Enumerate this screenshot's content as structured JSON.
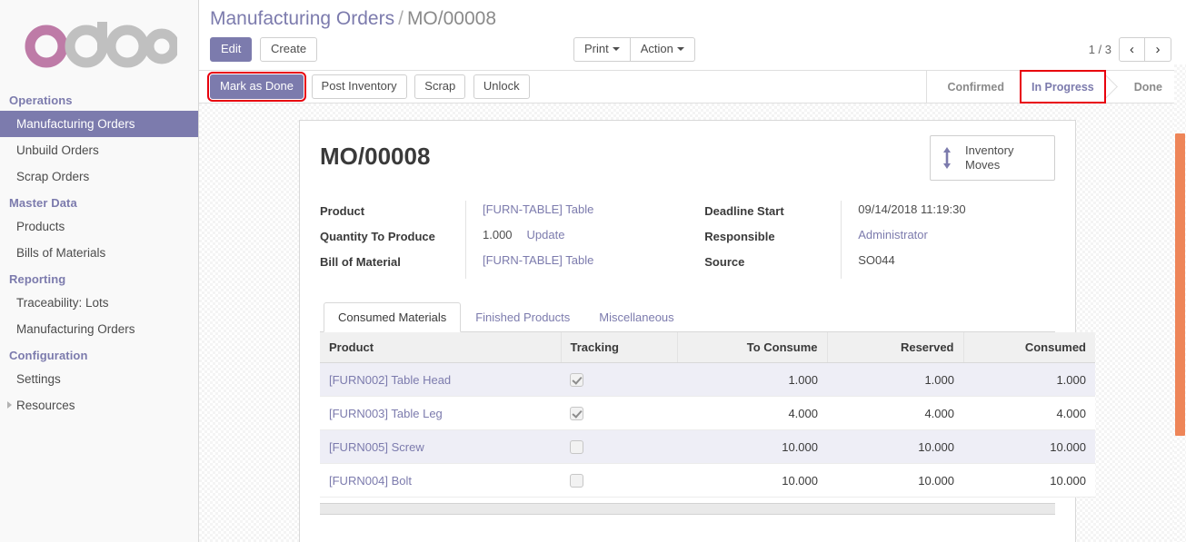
{
  "app": {
    "logo_alt": "odoo"
  },
  "sidebar": {
    "sections": [
      {
        "title": "Operations",
        "items": [
          {
            "label": "Manufacturing Orders",
            "active": true,
            "expandable": false
          },
          {
            "label": "Unbuild Orders",
            "active": false,
            "expandable": false
          },
          {
            "label": "Scrap Orders",
            "active": false,
            "expandable": false
          }
        ]
      },
      {
        "title": "Master Data",
        "items": [
          {
            "label": "Products",
            "active": false,
            "expandable": false
          },
          {
            "label": "Bills of Materials",
            "active": false,
            "expandable": false
          }
        ]
      },
      {
        "title": "Reporting",
        "items": [
          {
            "label": "Traceability: Lots",
            "active": false,
            "expandable": false
          },
          {
            "label": "Manufacturing Orders",
            "active": false,
            "expandable": false
          }
        ]
      },
      {
        "title": "Configuration",
        "items": [
          {
            "label": "Settings",
            "active": false,
            "expandable": false
          },
          {
            "label": "Resources",
            "active": false,
            "expandable": true
          }
        ]
      }
    ]
  },
  "breadcrumb": {
    "root": "Manufacturing Orders",
    "separator": "/",
    "current": "MO/00008"
  },
  "control_panel": {
    "edit_label": "Edit",
    "create_label": "Create",
    "print_label": "Print",
    "action_label": "Action",
    "pager_count": "1 / 3",
    "prev_icon": "‹",
    "next_icon": "›"
  },
  "action_bar": {
    "buttons": [
      {
        "label": "Mark as Done",
        "primary": true,
        "highlighted": true
      },
      {
        "label": "Post Inventory",
        "primary": false,
        "highlighted": false
      },
      {
        "label": "Scrap",
        "primary": false,
        "highlighted": false
      },
      {
        "label": "Unlock",
        "primary": false,
        "highlighted": false
      }
    ],
    "statusbar": [
      {
        "label": "Confirmed",
        "active": false,
        "highlighted": false
      },
      {
        "label": "In Progress",
        "active": true,
        "highlighted": true
      },
      {
        "label": "Done",
        "active": false,
        "highlighted": false
      }
    ]
  },
  "form": {
    "title": "MO/00008",
    "stat_button": {
      "label": "Inventory\nMoves",
      "icon": "up-down-arrow-icon"
    },
    "left_fields": [
      {
        "label": "Product",
        "value": "[FURN-TABLE] Table",
        "link": true
      },
      {
        "label": "Quantity To Produce",
        "value": "1.000",
        "link": false,
        "extra_link": "Update"
      },
      {
        "label": "Bill of Material",
        "value": "[FURN-TABLE] Table",
        "link": true
      }
    ],
    "right_fields": [
      {
        "label": "Deadline Start",
        "value": "09/14/2018 11:19:30",
        "link": false
      },
      {
        "label": "Responsible",
        "value": "Administrator",
        "link": true
      },
      {
        "label": "Source",
        "value": "SO044",
        "link": false
      }
    ]
  },
  "notebook": {
    "tabs": [
      {
        "label": "Consumed Materials",
        "active": true
      },
      {
        "label": "Finished Products",
        "active": false
      },
      {
        "label": "Miscellaneous",
        "active": false
      }
    ],
    "table": {
      "columns": [
        "Product",
        "Tracking",
        "To Consume",
        "Reserved",
        "Consumed"
      ],
      "rows": [
        {
          "product": "[FURN002] Table Head",
          "tracking": true,
          "to_consume": "1.000",
          "reserved": "1.000",
          "consumed": "1.000"
        },
        {
          "product": "[FURN003] Table Leg",
          "tracking": true,
          "to_consume": "4.000",
          "reserved": "4.000",
          "consumed": "4.000"
        },
        {
          "product": "[FURN005] Screw",
          "tracking": false,
          "to_consume": "10.000",
          "reserved": "10.000",
          "consumed": "10.000"
        },
        {
          "product": "[FURN004] Bolt",
          "tracking": false,
          "to_consume": "10.000",
          "reserved": "10.000",
          "consumed": "10.000"
        }
      ]
    }
  },
  "colors": {
    "brand_purple": "#7c7bad",
    "logo_pink": "#be7ba7",
    "logo_grey": "#c0c0c0",
    "highlight_red": "#e8000d",
    "scrollbar_orange": "#ee8558",
    "row_alt": "#eeeef6"
  }
}
